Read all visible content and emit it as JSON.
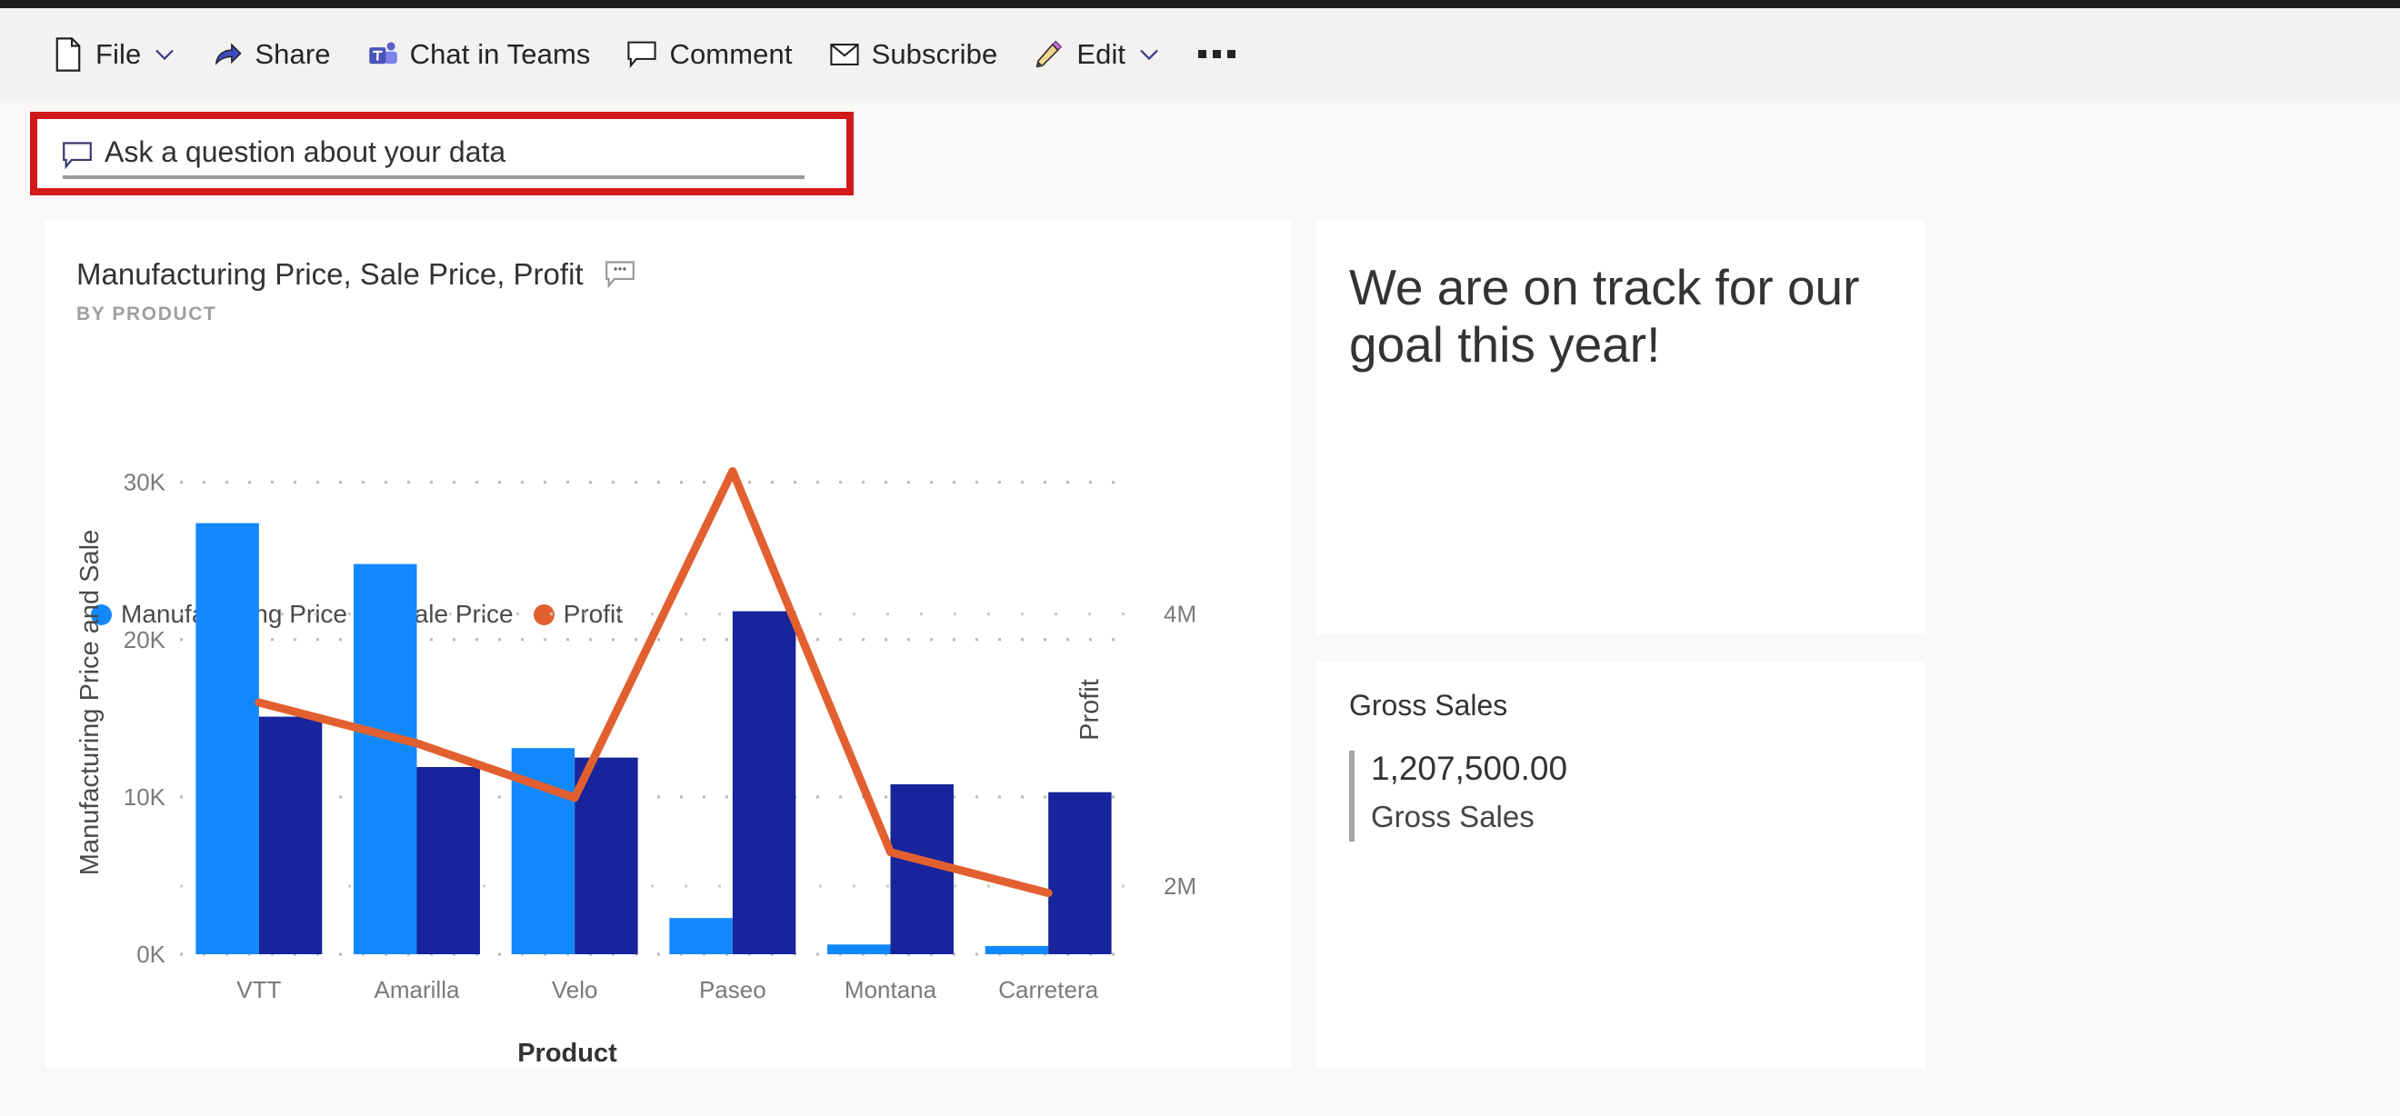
{
  "toolbar": {
    "items": [
      {
        "label": "File",
        "icon": "file-icon",
        "has_chevron": true
      },
      {
        "label": "Share",
        "icon": "share-icon",
        "has_chevron": false
      },
      {
        "label": "Chat in Teams",
        "icon": "teams-icon",
        "has_chevron": false
      },
      {
        "label": "Comment",
        "icon": "comment-icon",
        "has_chevron": false
      },
      {
        "label": "Subscribe",
        "icon": "mail-icon",
        "has_chevron": false
      },
      {
        "label": "Edit",
        "icon": "pencil-icon",
        "has_chevron": true
      }
    ],
    "more_label": "More options"
  },
  "qna": {
    "placeholder": "Ask a question about your data",
    "value": "",
    "icon": "qna-chat-icon",
    "highlight_color": "#d01a1a"
  },
  "chart_card": {
    "title": "Manufacturing Price, Sale Price, Profit",
    "subtitle": "BY PRODUCT",
    "info_icon": "chart-info-icon"
  },
  "text_card": {
    "text": "We are on track for our goal this year!"
  },
  "kpi_card": {
    "title": "Gross Sales",
    "value": "1,207,500.00",
    "subtitle": "Gross Sales"
  },
  "colors": {
    "manufacturing_price": "#1189fc",
    "sale_price": "#17249c",
    "profit": "#e2602f",
    "canvas_background": "#f9f8f7",
    "card_background": "#ffffff",
    "command_bar": "#f3f2f1"
  },
  "chart_data": {
    "type": "bar",
    "title": "Manufacturing Price, Sale Price, Profit",
    "subtitle": "BY PRODUCT",
    "xlabel": "Product",
    "ylabel": "Manufacturing Price and Sale",
    "y2label": "Profit",
    "categories": [
      "VTT",
      "Amarilla",
      "Velo",
      "Paseo",
      "Montana",
      "Carretera"
    ],
    "ylim": [
      0,
      32000
    ],
    "yticks": [
      0,
      10000,
      20000,
      30000
    ],
    "ytick_labels": [
      "0K",
      "10K",
      "20K",
      "30K"
    ],
    "y2lim": [
      1500000,
      5200000
    ],
    "y2ticks": [
      2000000,
      4000000
    ],
    "y2tick_labels": [
      "2M",
      "4M"
    ],
    "grid": true,
    "legend_position": "top-left",
    "series": [
      {
        "name": "Manufacturing Price",
        "type": "bar",
        "axis": "left",
        "color": "#1189fc",
        "values": [
          27400,
          24800,
          13100,
          2300,
          620,
          520
        ]
      },
      {
        "name": "Sale Price",
        "type": "bar",
        "axis": "left",
        "color": "#17249c",
        "values": [
          15100,
          11900,
          12500,
          21800,
          10800,
          10300
        ]
      },
      {
        "name": "Profit",
        "type": "line",
        "axis": "right",
        "color": "#e2602f",
        "values": [
          3350000,
          3050000,
          2650000,
          5050000,
          2250000,
          1950000
        ]
      }
    ]
  }
}
